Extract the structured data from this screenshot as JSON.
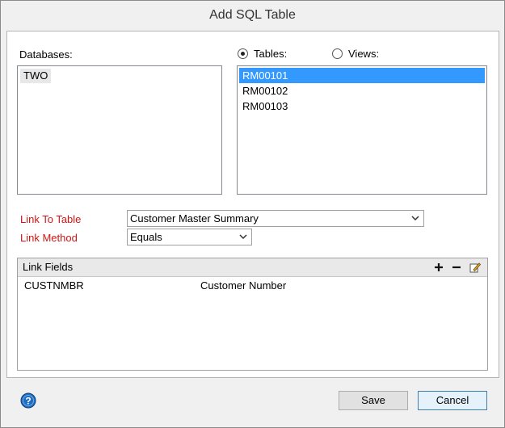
{
  "window": {
    "title": "Add SQL Table"
  },
  "databases": {
    "label": "Databases:",
    "items": [
      "TWO"
    ]
  },
  "source": {
    "tables_label": "Tables:",
    "views_label": "Views:",
    "selected": "tables",
    "items": [
      "RM00101",
      "RM00102",
      "RM00103"
    ],
    "selected_index": 0
  },
  "link_to_table": {
    "label": "Link To Table",
    "value": "Customer Master Summary"
  },
  "link_method": {
    "label": "Link Method",
    "value": "Equals"
  },
  "link_fields": {
    "title": "Link Fields",
    "rows": [
      {
        "field": "CUSTNMBR",
        "description": "Customer Number"
      }
    ]
  },
  "buttons": {
    "save": "Save",
    "cancel": "Cancel"
  },
  "colors": {
    "required_label": "#d11414",
    "selection": "#3399ff",
    "help_icon": "#1e6fc4"
  }
}
